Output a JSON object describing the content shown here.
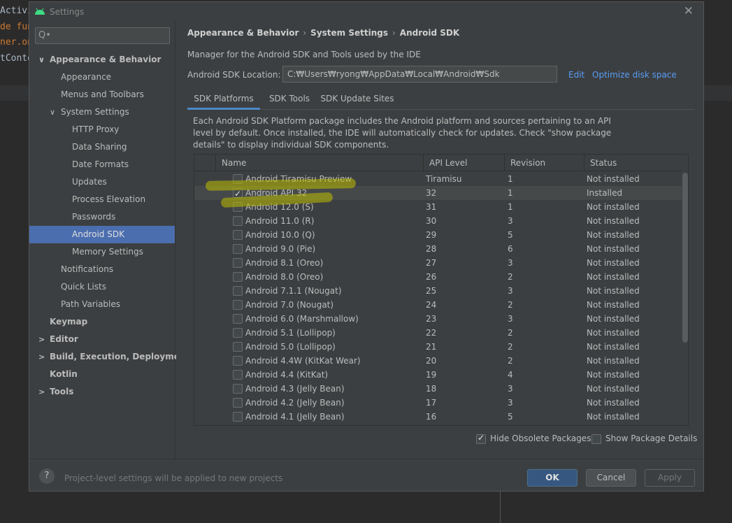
{
  "editor_bg": {
    "lines": [
      {
        "text": "Activi",
        "color": "#a9b7c6",
        "y": 17
      },
      {
        "text": "de fun",
        "color": "#cc7832",
        "y": 42
      },
      {
        "text": "ner.on",
        "color": "#cc7832",
        "y": 65
      },
      {
        "text": "tConte",
        "color": "#a9b7c6",
        "y": 87
      }
    ]
  },
  "dialog": {
    "title": "Settings",
    "close_glyph": "✕"
  },
  "sidebar": {
    "search_glyph": "Q•",
    "items": [
      {
        "label": "Appearance & Behavior",
        "bold": true,
        "arrow": "∨"
      },
      {
        "label": "Appearance"
      },
      {
        "label": "Menus and Toolbars"
      },
      {
        "label": "System Settings",
        "arrow": "∨"
      },
      {
        "label": "HTTP Proxy"
      },
      {
        "label": "Data Sharing"
      },
      {
        "label": "Date Formats"
      },
      {
        "label": "Updates"
      },
      {
        "label": "Process Elevation"
      },
      {
        "label": "Passwords"
      },
      {
        "label": "Android SDK",
        "selected": true
      },
      {
        "label": "Memory Settings"
      },
      {
        "label": "Notifications"
      },
      {
        "label": "Quick Lists"
      },
      {
        "label": "Path Variables"
      },
      {
        "label": "Keymap",
        "bold": true
      },
      {
        "label": "Editor",
        "bold": true,
        "arrow": ">"
      },
      {
        "label": "Build, Execution, Deployment",
        "bold": true,
        "arrow": ">"
      },
      {
        "label": "Kotlin",
        "bold": true
      },
      {
        "label": "Tools",
        "bold": true,
        "arrow": ">"
      }
    ]
  },
  "main": {
    "breadcrumb": [
      "Appearance & Behavior",
      "System Settings",
      "Android SDK"
    ],
    "breadcrumb_sep": "›",
    "description": "Manager for the Android SDK and Tools used by the IDE",
    "location_label": "Android SDK Location:",
    "location_value": "C:₩Users₩ryong₩AppData₩Local₩Android₩Sdk",
    "edit_label": "Edit",
    "optimize_label": "Optimize disk space",
    "tabs": [
      "SDK Platforms",
      "SDK Tools",
      "SDK Update Sites"
    ],
    "active_tab": 0,
    "paragraph": "Each Android SDK Platform package includes the Android platform and sources pertaining to an API level by default. Once installed, the IDE will automatically check for updates. Check \"show package details\" to display individual SDK components.",
    "columns": [
      "Name",
      "API Level",
      "Revision",
      "Status"
    ],
    "rows": [
      {
        "name": "Android Tiramisu Preview",
        "api": "Tiramisu",
        "rev": "1",
        "status": "Not installed",
        "checked": false
      },
      {
        "name": "Android API 32",
        "api": "32",
        "rev": "1",
        "status": "Installed",
        "checked": true
      },
      {
        "name": "Android 12.0 (S)",
        "api": "31",
        "rev": "1",
        "status": "Not installed",
        "checked": false
      },
      {
        "name": "Android 11.0 (R)",
        "api": "30",
        "rev": "3",
        "status": "Not installed",
        "checked": false
      },
      {
        "name": "Android 10.0 (Q)",
        "api": "29",
        "rev": "5",
        "status": "Not installed",
        "checked": false
      },
      {
        "name": "Android 9.0 (Pie)",
        "api": "28",
        "rev": "6",
        "status": "Not installed",
        "checked": false
      },
      {
        "name": "Android 8.1 (Oreo)",
        "api": "27",
        "rev": "3",
        "status": "Not installed",
        "checked": false
      },
      {
        "name": "Android 8.0 (Oreo)",
        "api": "26",
        "rev": "2",
        "status": "Not installed",
        "checked": false
      },
      {
        "name": "Android 7.1.1 (Nougat)",
        "api": "25",
        "rev": "3",
        "status": "Not installed",
        "checked": false
      },
      {
        "name": "Android 7.0 (Nougat)",
        "api": "24",
        "rev": "2",
        "status": "Not installed",
        "checked": false
      },
      {
        "name": "Android 6.0 (Marshmallow)",
        "api": "23",
        "rev": "3",
        "status": "Not installed",
        "checked": false
      },
      {
        "name": "Android 5.1 (Lollipop)",
        "api": "22",
        "rev": "2",
        "status": "Not installed",
        "checked": false
      },
      {
        "name": "Android 5.0 (Lollipop)",
        "api": "21",
        "rev": "2",
        "status": "Not installed",
        "checked": false
      },
      {
        "name": "Android 4.4W (KitKat Wear)",
        "api": "20",
        "rev": "2",
        "status": "Not installed",
        "checked": false
      },
      {
        "name": "Android 4.4 (KitKat)",
        "api": "19",
        "rev": "4",
        "status": "Not installed",
        "checked": false
      },
      {
        "name": "Android 4.3 (Jelly Bean)",
        "api": "18",
        "rev": "3",
        "status": "Not installed",
        "checked": false
      },
      {
        "name": "Android 4.2 (Jelly Bean)",
        "api": "17",
        "rev": "3",
        "status": "Not installed",
        "checked": false
      },
      {
        "name": "Android 4.1 (Jelly Bean)",
        "api": "16",
        "rev": "5",
        "status": "Not installed",
        "checked": false
      }
    ],
    "hide_obsolete_label": "Hide Obsolete Packages",
    "hide_obsolete_checked": true,
    "show_details_label": "Show Package Details",
    "show_details_checked": false
  },
  "footer": {
    "help_glyph": "?",
    "text": "Project-level settings will be applied to new projects",
    "ok_label": "OK",
    "cancel_label": "Cancel",
    "apply_label": "Apply"
  },
  "colors": {
    "accent": "#4b6eaf",
    "link": "#589df6",
    "highlight": "#bebe00",
    "ok_button": "#365880"
  }
}
